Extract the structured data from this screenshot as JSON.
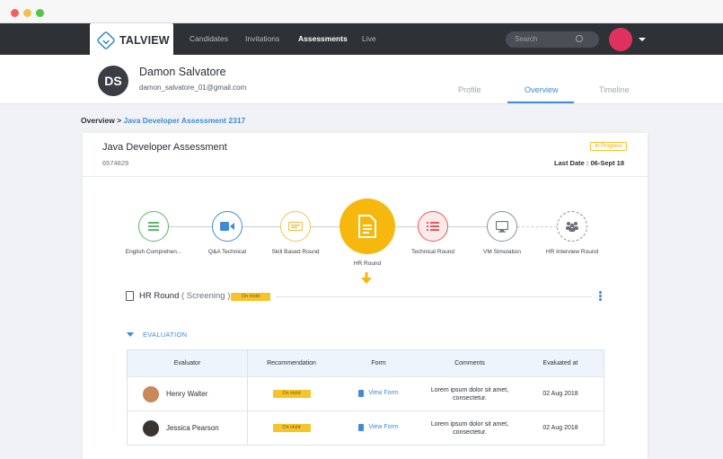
{
  "app": {
    "logo_text": "TALVIEW"
  },
  "nav": {
    "links": [
      "Candidates",
      "Invitations",
      "Assessments",
      "Live"
    ],
    "active": "Assessments",
    "search_placeholder": "Search"
  },
  "profile": {
    "initials": "DS",
    "name": "Damon Salvatore",
    "email": "damon_salvatore_01@gmail.com",
    "tabs": [
      "Profile",
      "Overview",
      "Timeline"
    ],
    "active_tab": "Overview"
  },
  "breadcrumb": {
    "root": "Overview >",
    "current": "Java Developer Assessment 2317"
  },
  "assessment": {
    "title": "Java Developer Assessment",
    "id": "6574829",
    "status": "In Progress",
    "last_date": "Last Date : 06-Sept 18"
  },
  "stages": [
    {
      "label": "English Comprehen...",
      "icon": "list-icon",
      "color": "#5bb86a"
    },
    {
      "label": "Q&A Technical",
      "icon": "video-camera-icon",
      "color": "#3f8bd6"
    },
    {
      "label": "Skill Based Round",
      "icon": "code-icon",
      "color": "#f0c454"
    },
    {
      "label": "HR Round",
      "icon": "document-icon",
      "color": "#f6b80d"
    },
    {
      "label": "Technical Round",
      "icon": "checklist-icon",
      "color": "#e8575a"
    },
    {
      "label": "VM Simulation",
      "icon": "monitor-icon",
      "color": "#8a8f96"
    },
    {
      "label": "HR Interview Round",
      "icon": "group-icon",
      "color": "#8a8f96"
    }
  ],
  "round": {
    "title": "HR Round",
    "subtitle": "( Screening )",
    "status": "On Hold"
  },
  "evaluation": {
    "label": "EVALUATION",
    "columns": [
      "Evaluator",
      "Recommendation",
      "Form",
      "Comments",
      "Evaluated at"
    ],
    "rows": [
      {
        "evaluator": "Henry Walter",
        "recommendation": "On Hold",
        "form": "View Form",
        "comments": "Lorem ipsum dolor sit amet, consectetur.",
        "evaluated_at": "02 Aug 2018"
      },
      {
        "evaluator": "Jessica Pearson",
        "recommendation": "On Hold",
        "form": "View Form",
        "comments": "Lorem ipsum dolor sit amet, consectetur.",
        "evaluated_at": "02 Aug 2018"
      }
    ]
  }
}
